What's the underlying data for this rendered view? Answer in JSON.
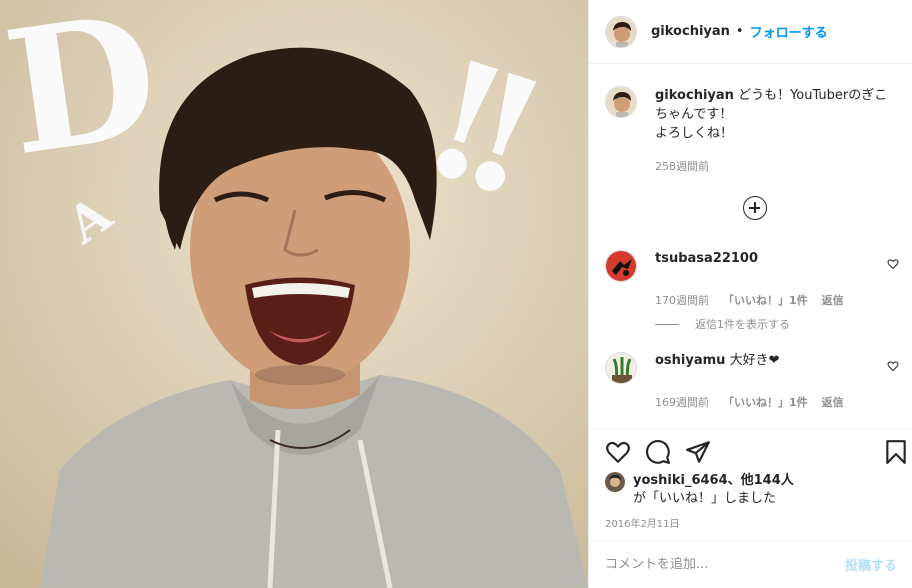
{
  "photo": {
    "letter_d": "D",
    "letter_a": "A",
    "bangs": "!!"
  },
  "header": {
    "username": "gikochiyan",
    "separator": "•",
    "follow_label": "フォローする"
  },
  "caption": {
    "username": "gikochiyan",
    "text_line1": "どうも！YouTuberのぎこ",
    "text_line2": "ちゃんです！",
    "text_line3": "よろしくね！",
    "timestamp": "258週間前"
  },
  "comments": [
    {
      "username": "tsubasa22100",
      "text": "",
      "timestamp": "170週間前",
      "likes": "「いいね！」1件",
      "reply_label": "返信",
      "view_replies": "返信1件を表示する"
    },
    {
      "username": "oshiyamu",
      "text": "大好き❤",
      "timestamp": "169週間前",
      "likes": "「いいね！」1件",
      "reply_label": "返信"
    }
  ],
  "likes_section": {
    "liker": "yoshiki_6464",
    "others": "、他144人",
    "line2": "が「いいね！」しました"
  },
  "date": "2016年2月11日",
  "add_comment": {
    "placeholder": "コメントを追加...",
    "post_label": "投稿する"
  },
  "colors": {
    "accent": "#0095f6",
    "post_disabled": "#b2dffc",
    "muted": "#8e8e8e"
  }
}
